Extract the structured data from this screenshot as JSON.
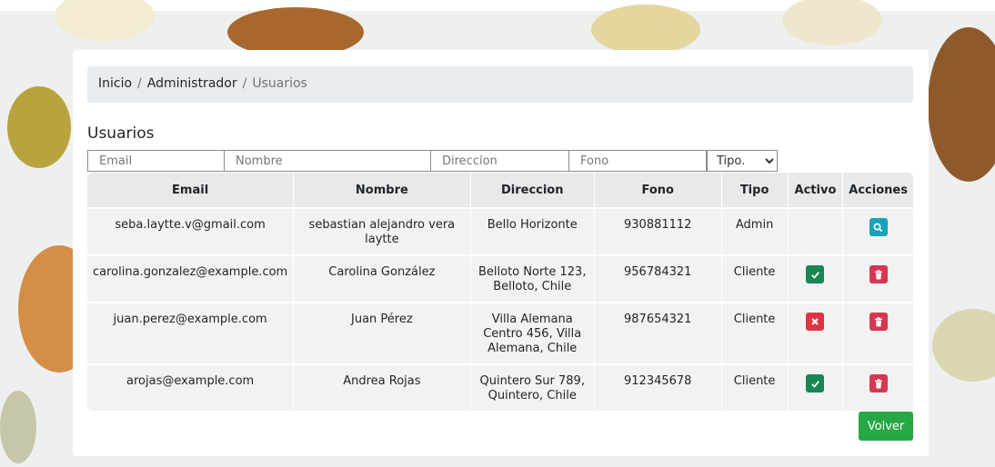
{
  "breadcrumb": {
    "items": [
      "Inicio",
      "Administrador",
      "Usuarios"
    ],
    "separator": "/"
  },
  "page_title": "Usuarios",
  "filters": {
    "email_placeholder": "Email",
    "nombre_placeholder": "Nombre",
    "direccion_placeholder": "Direccion",
    "fono_placeholder": "Fono",
    "tipo_selected": "Tipo."
  },
  "table": {
    "headers": [
      "Email",
      "Nombre",
      "Direccion",
      "Fono",
      "Tipo",
      "Activo",
      "Acciones"
    ],
    "rows": [
      {
        "email": "seba.laytte.v@gmail.com",
        "nombre": "sebastian alejandro vera laytte",
        "direccion": "Bello Horizonte",
        "fono": "930881112",
        "tipo": "Admin",
        "activo": "",
        "accion": "search-icon"
      },
      {
        "email": "carolina.gonzalez@example.com",
        "nombre": "Carolina González",
        "direccion": "Belloto Norte 123, Belloto, Chile",
        "fono": "956784321",
        "tipo": "Cliente",
        "activo": "check-icon",
        "accion": "trash-icon"
      },
      {
        "email": "juan.perez@example.com",
        "nombre": "Juan Pérez",
        "direccion": "Villa Alemana Centro 456, Villa Alemana, Chile",
        "fono": "987654321",
        "tipo": "Cliente",
        "activo": "x-icon",
        "accion": "trash-icon"
      },
      {
        "email": "arojas@example.com",
        "nombre": "Andrea Rojas",
        "direccion": "Quintero Sur 789, Quintero, Chile",
        "fono": "912345678",
        "tipo": "Cliente",
        "activo": "check-icon",
        "accion": "trash-icon"
      }
    ]
  },
  "volver_label": "Volver",
  "colors": {
    "success": "#198754",
    "danger": "#dc3545",
    "info": "#17a2b8",
    "volver": "#28a745"
  }
}
